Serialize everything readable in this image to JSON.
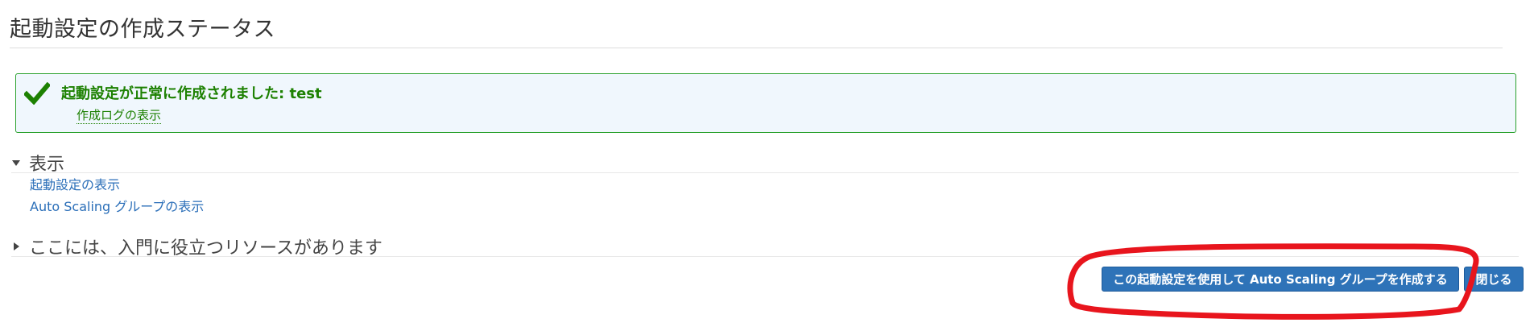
{
  "page": {
    "title": "起動設定の作成ステータス"
  },
  "alert": {
    "message": "起動設定が正常に作成されました: test",
    "log_link": "作成ログの表示",
    "color": "#1d8102",
    "icon": "check-icon"
  },
  "display_section": {
    "title": "表示",
    "expanded": true,
    "links": [
      "起動設定の表示",
      "Auto Scaling グループの表示"
    ]
  },
  "resources_section": {
    "title": "ここには、入門に役立つリソースがあります",
    "expanded": false
  },
  "actions": {
    "create_asg": "この起動設定を使用して Auto Scaling グループを作成する",
    "close": "閉じる"
  },
  "annotation": {
    "color": "#e8151d",
    "shape": "freehand-ellipse"
  }
}
